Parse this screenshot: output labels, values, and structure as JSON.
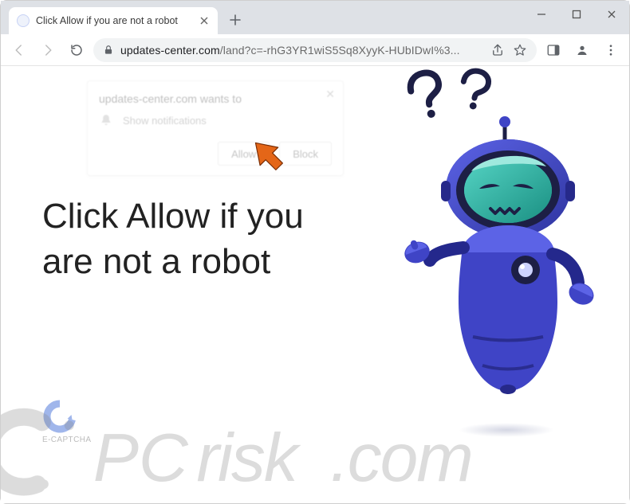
{
  "window": {
    "tab_title": "Click Allow if you are not a robot",
    "minimize": "Minimize",
    "maximize": "Maximize",
    "close": "Close"
  },
  "address": {
    "domain": "updates-center.com",
    "path": "/land?c=-rhG3YR1wiS5Sq8XyyK-HUbIDwI%3..."
  },
  "notification": {
    "title": "updates-center.com wants to",
    "line": "Show notifications",
    "allow": "Allow",
    "block": "Block"
  },
  "page": {
    "heading": "Click Allow if you are not a robot",
    "captcha": "E-CAPTCHA"
  },
  "watermark": {
    "text": "PCrisk.com"
  },
  "colors": {
    "robot_primary": "#4045c8",
    "robot_dark": "#2a2f8d",
    "accent_orange": "#e46618"
  }
}
